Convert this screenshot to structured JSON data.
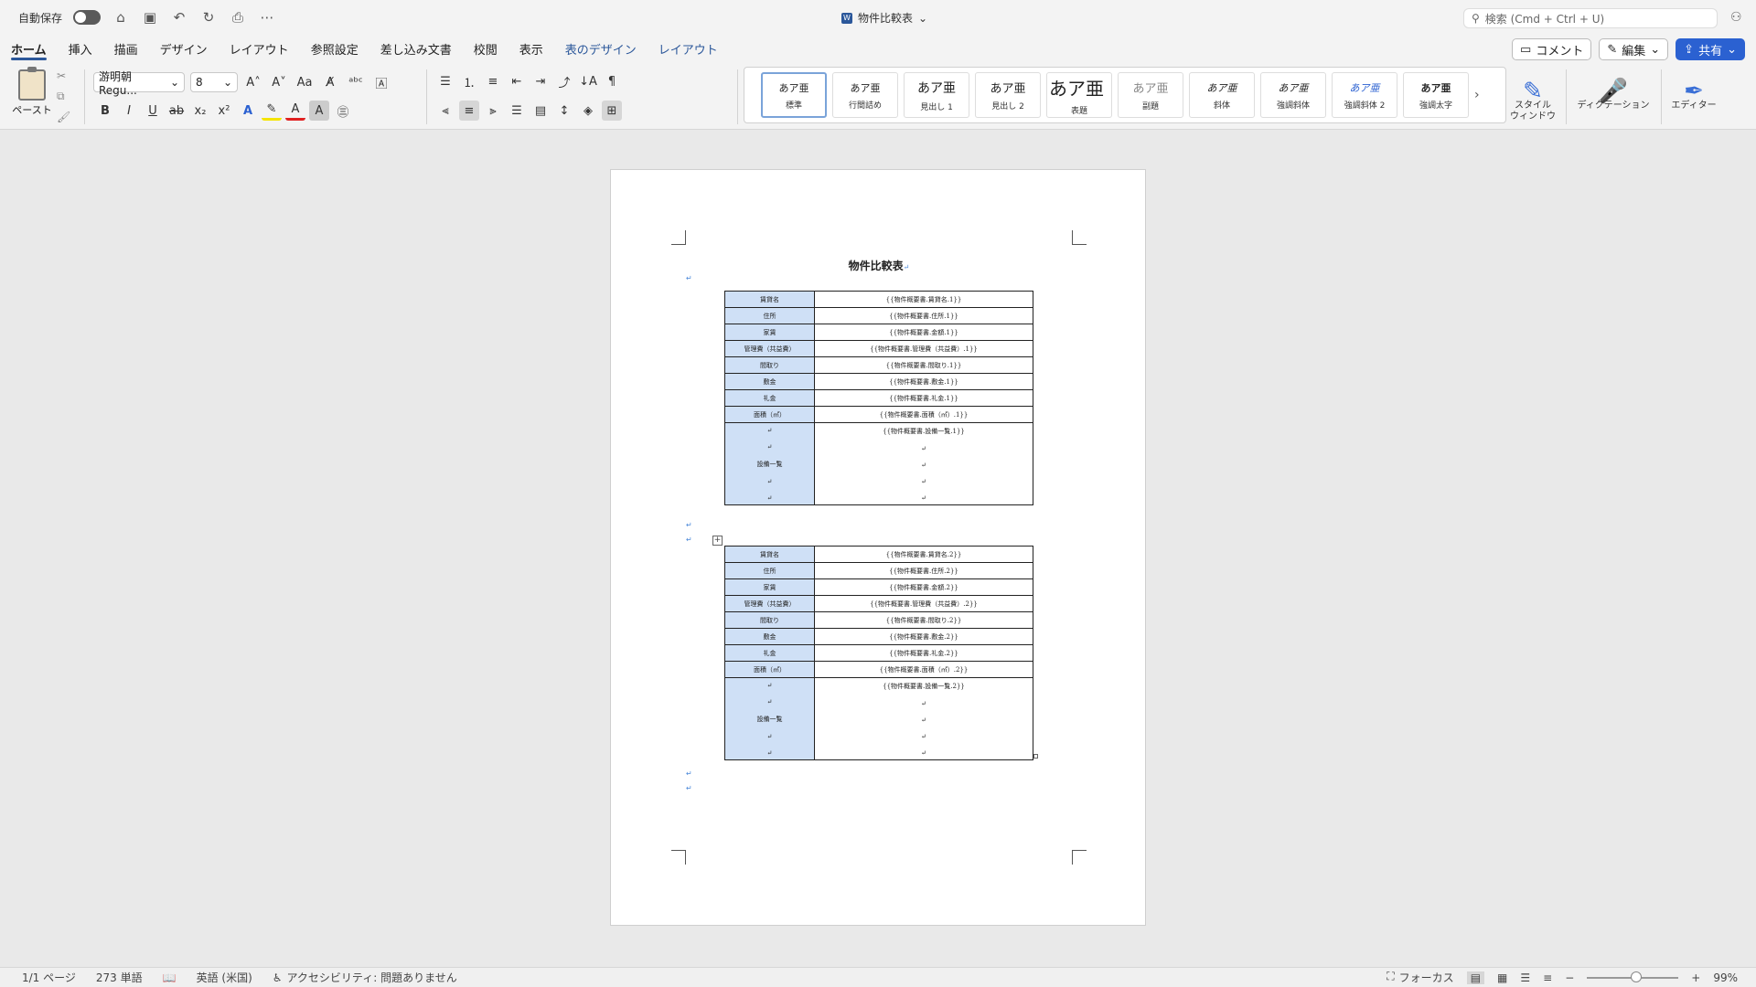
{
  "titlebar": {
    "autosave_label": "自動保存",
    "doc_title": "物件比較表",
    "search_placeholder": "検索 (Cmd + Ctrl + U)"
  },
  "tabs": [
    "ホーム",
    "挿入",
    "描画",
    "デザイン",
    "レイアウト",
    "参照設定",
    "差し込み文書",
    "校閲",
    "表示",
    "表のデザイン",
    "レイアウト"
  ],
  "actions": {
    "comment": "コメント",
    "edit": "編集",
    "share": "共有"
  },
  "ribbon": {
    "paste_label": "ペースト",
    "font_name": "游明朝 Regu...",
    "font_size": "8",
    "styles": [
      {
        "preview": "あア亜",
        "name": "標準"
      },
      {
        "preview": "あア亜",
        "name": "行間詰め"
      },
      {
        "preview": "あア亜",
        "name": "見出し 1"
      },
      {
        "preview": "あア亜",
        "name": "見出し 2"
      },
      {
        "preview": "あア亜",
        "name": "表題"
      },
      {
        "preview": "あア亜",
        "name": "副題"
      },
      {
        "preview": "あア亜",
        "name": "斜体"
      },
      {
        "preview": "あア亜",
        "name": "強調斜体"
      },
      {
        "preview": "あア亜",
        "name": "強調斜体 2"
      },
      {
        "preview": "あア亜",
        "name": "強調太字"
      }
    ],
    "style_window": "スタイル\nウィンドウ",
    "dictation": "ディクテーション",
    "editor": "エディター"
  },
  "document": {
    "heading": "物件比較表",
    "para_mark": "↵",
    "tables": [
      {
        "rows": [
          {
            "label": "賃貸名",
            "value": "{{物件概要書.賃貸名.1}}"
          },
          {
            "label": "住所",
            "value": "{{物件概要書.住所.1}}"
          },
          {
            "label": "家賃",
            "value": "{{物件概要書.金額.1}}"
          },
          {
            "label": "管理費（共益費）",
            "value": "{{物件概要書.管理費（共益費）.1}}"
          },
          {
            "label": "間取り",
            "value": "{{物件概要書.間取り.1}}"
          },
          {
            "label": "敷金",
            "value": "{{物件概要書.敷金.1}}"
          },
          {
            "label": "礼金",
            "value": "{{物件概要書.礼金.1}}"
          },
          {
            "label": "面積（㎡）",
            "value": "{{物件概要書.面積（㎡）.1}}"
          }
        ],
        "facility": {
          "label": "設備一覧",
          "value": "{{物件概要書.設備一覧.1}}"
        }
      },
      {
        "rows": [
          {
            "label": "賃貸名",
            "value": "{{物件概要書.賃貸名.2}}"
          },
          {
            "label": "住所",
            "value": "{{物件概要書.住所.2}}"
          },
          {
            "label": "家賃",
            "value": "{{物件概要書.金額.2}}"
          },
          {
            "label": "管理費（共益費）",
            "value": "{{物件概要書.管理費（共益費）.2}}"
          },
          {
            "label": "間取り",
            "value": "{{物件概要書.間取り.2}}"
          },
          {
            "label": "敷金",
            "value": "{{物件概要書.敷金.2}}"
          },
          {
            "label": "礼金",
            "value": "{{物件概要書.礼金.2}}"
          },
          {
            "label": "面積（㎡）",
            "value": "{{物件概要書.面積（㎡）.2}}"
          }
        ],
        "facility": {
          "label": "設備一覧",
          "value": "{{物件概要書.設備一覧.2}}"
        }
      }
    ]
  },
  "statusbar": {
    "page": "1/1 ページ",
    "words": "273 単語",
    "language": "英語 (米国)",
    "accessibility": "アクセシビリティ: 問題ありません",
    "focus": "フォーカス",
    "zoom": "99%"
  }
}
